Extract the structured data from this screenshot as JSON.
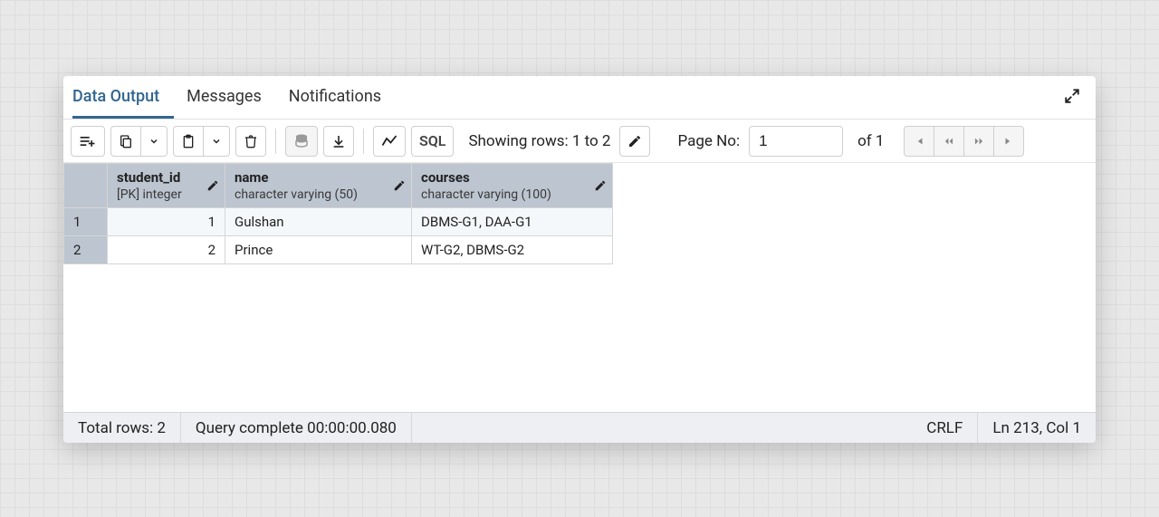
{
  "tabs": {
    "data_output": "Data Output",
    "messages": "Messages",
    "notifications": "Notifications"
  },
  "toolbar": {
    "rows_showing": "Showing rows: 1 to 2",
    "page_no_label": "Page No:",
    "page_no_value": "1",
    "page_total": "of 1",
    "sql_label": "SQL"
  },
  "columns": [
    {
      "name": "student_id",
      "type": "[PK] integer"
    },
    {
      "name": "name",
      "type": "character varying (50)"
    },
    {
      "name": "courses",
      "type": "character varying (100)"
    }
  ],
  "rows": [
    {
      "n": "1",
      "student_id": "1",
      "name": "Gulshan",
      "courses": "DBMS-G1, DAA-G1"
    },
    {
      "n": "2",
      "student_id": "2",
      "name": "Prince",
      "courses": "WT-G2, DBMS-G2"
    }
  ],
  "status": {
    "total_rows": "Total rows: 2",
    "query_complete": "Query complete 00:00:00.080",
    "eol": "CRLF",
    "cursor": "Ln 213, Col 1"
  }
}
